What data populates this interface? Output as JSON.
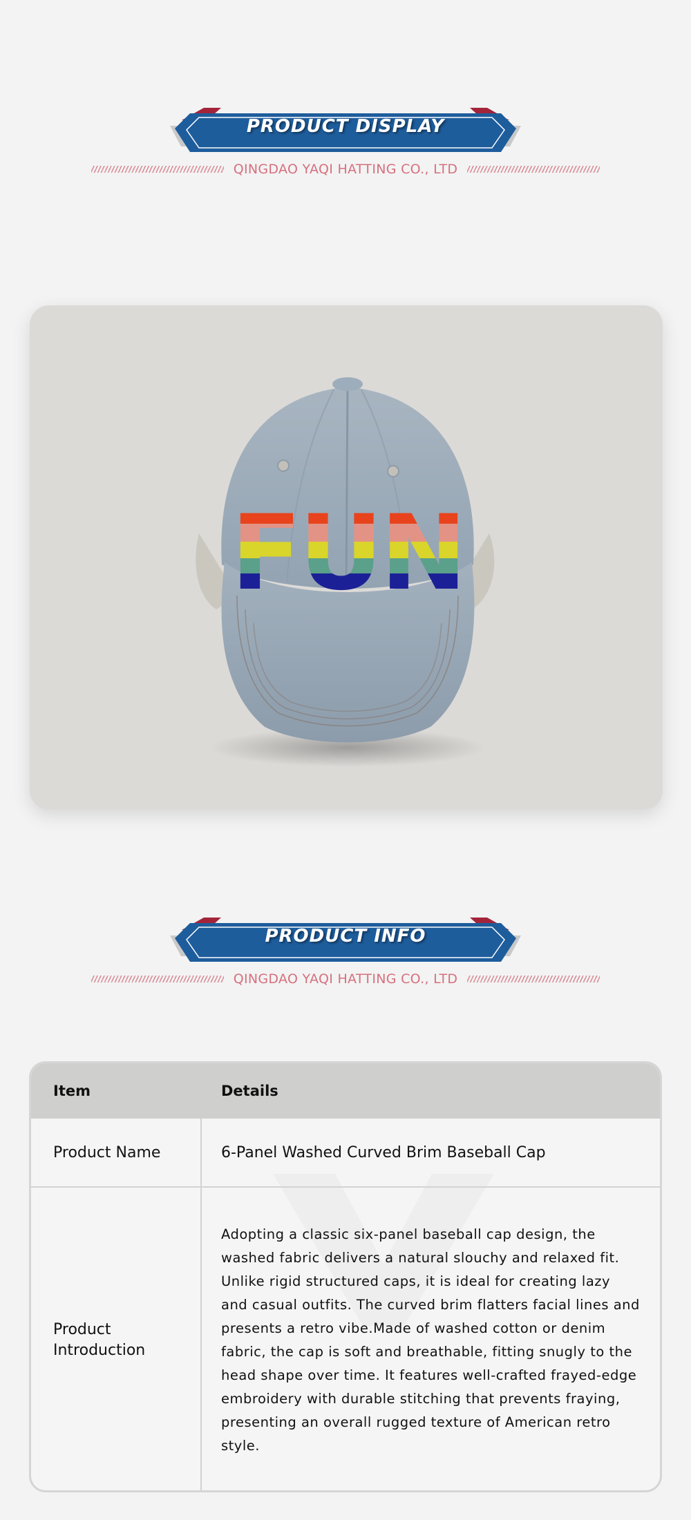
{
  "sections": {
    "display": {
      "title": "PRODUCT DISPLAY",
      "company": "QINGDAO YAQI HATTING CO., LTD"
    },
    "info": {
      "title": "PRODUCT INFO",
      "company": "QINGDAO YAQI HATTING CO., LTD"
    }
  },
  "photo": {
    "embroidery_text": "FUN",
    "embroidery_colors": [
      "#e8431c",
      "#e29386",
      "#d9d52b",
      "#5aa08a",
      "#1c2096"
    ],
    "cap_color": "#a9b7c4"
  },
  "table": {
    "header": {
      "item": "Item",
      "details": "Details"
    },
    "rows": [
      {
        "item": "Product Name",
        "details": "6-Panel Washed Curved Brim Baseball Cap"
      },
      {
        "item": "Product Introduction",
        "details": "Adopting a classic six-panel baseball cap design, the washed fabric delivers a natural slouchy and relaxed fit. Unlike rigid structured caps, it is ideal for creating lazy and casual outfits. The curved brim flatters facial lines and presents a retro vibe.Made of washed cotton or denim fabric, the cap is soft and breathable, fitting snugly to the head shape over time. It features well-crafted frayed-edge embroidery with durable stitching that prevents fraying, presenting an overall rugged texture of American retro style."
      }
    ]
  },
  "colors": {
    "background": "#f3f3f3",
    "banner_blue": "#1e5d9c",
    "banner_red": "#a3243a",
    "banner_grey": "#c9c9c9",
    "accent_pink": "#d6707e",
    "table_header": "#cfcfce"
  }
}
